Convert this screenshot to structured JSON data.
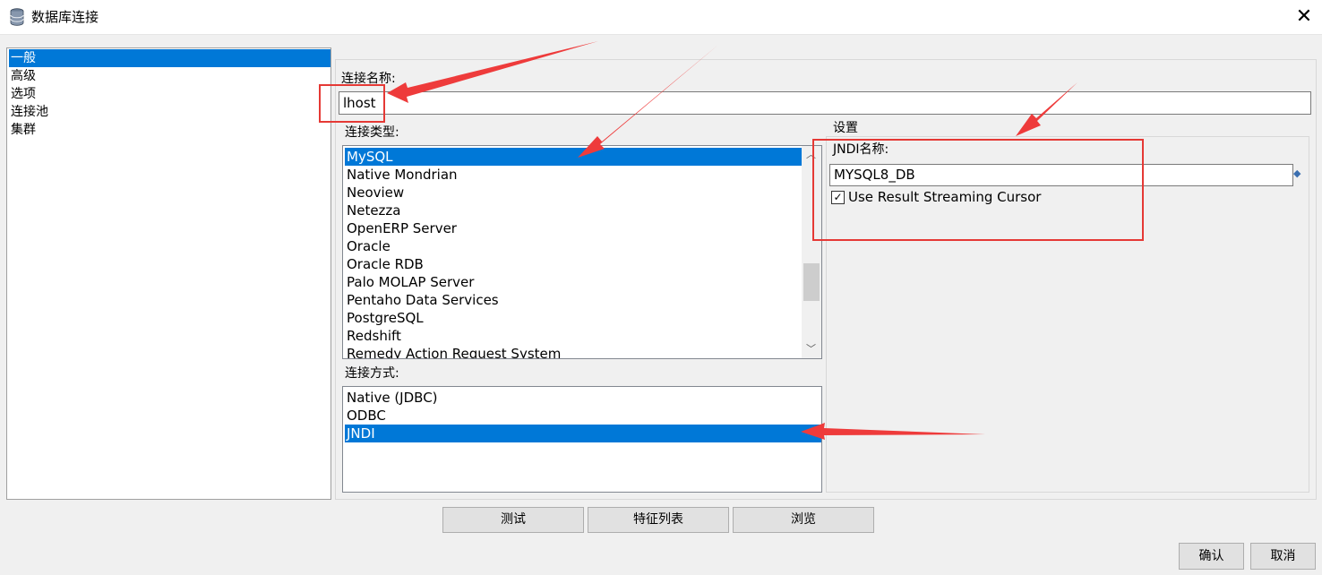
{
  "window": {
    "title": "数据库连接",
    "close_glyph": "✕"
  },
  "nav": {
    "items": [
      "一般",
      "高级",
      "选项",
      "连接池",
      "集群"
    ],
    "selected_index": 0
  },
  "connection_name": {
    "label": "连接名称:",
    "value": "lhost"
  },
  "connection_type": {
    "label": "连接类型:",
    "items": [
      "MySQL",
      "Native Mondrian",
      "Neoview",
      "Netezza",
      "OpenERP Server",
      "Oracle",
      "Oracle RDB",
      "Palo MOLAP Server",
      "Pentaho Data Services",
      "PostgreSQL",
      "Redshift",
      "Remedy Action Request System"
    ],
    "selected": "MySQL"
  },
  "access_method": {
    "label": "连接方式:",
    "items": [
      "Native (JDBC)",
      "ODBC",
      "JNDI"
    ],
    "selected": "JNDI"
  },
  "settings": {
    "title": "设置",
    "jndi_label": "JNDI名称:",
    "jndi_value": "MYSQL8_DB",
    "streaming_cursor_label": "Use Result Streaming Cursor",
    "streaming_cursor_checked": true,
    "check_glyph": "✓"
  },
  "buttons": {
    "test": "测试",
    "features": "特征列表",
    "browse": "浏览",
    "ok": "确认",
    "cancel": "取消"
  },
  "glyphs": {
    "scroll_up": "︿",
    "scroll_down": "﹀",
    "var_icon": "◆"
  },
  "colors": {
    "selection": "#0078d7",
    "annotation": "#e53935"
  }
}
